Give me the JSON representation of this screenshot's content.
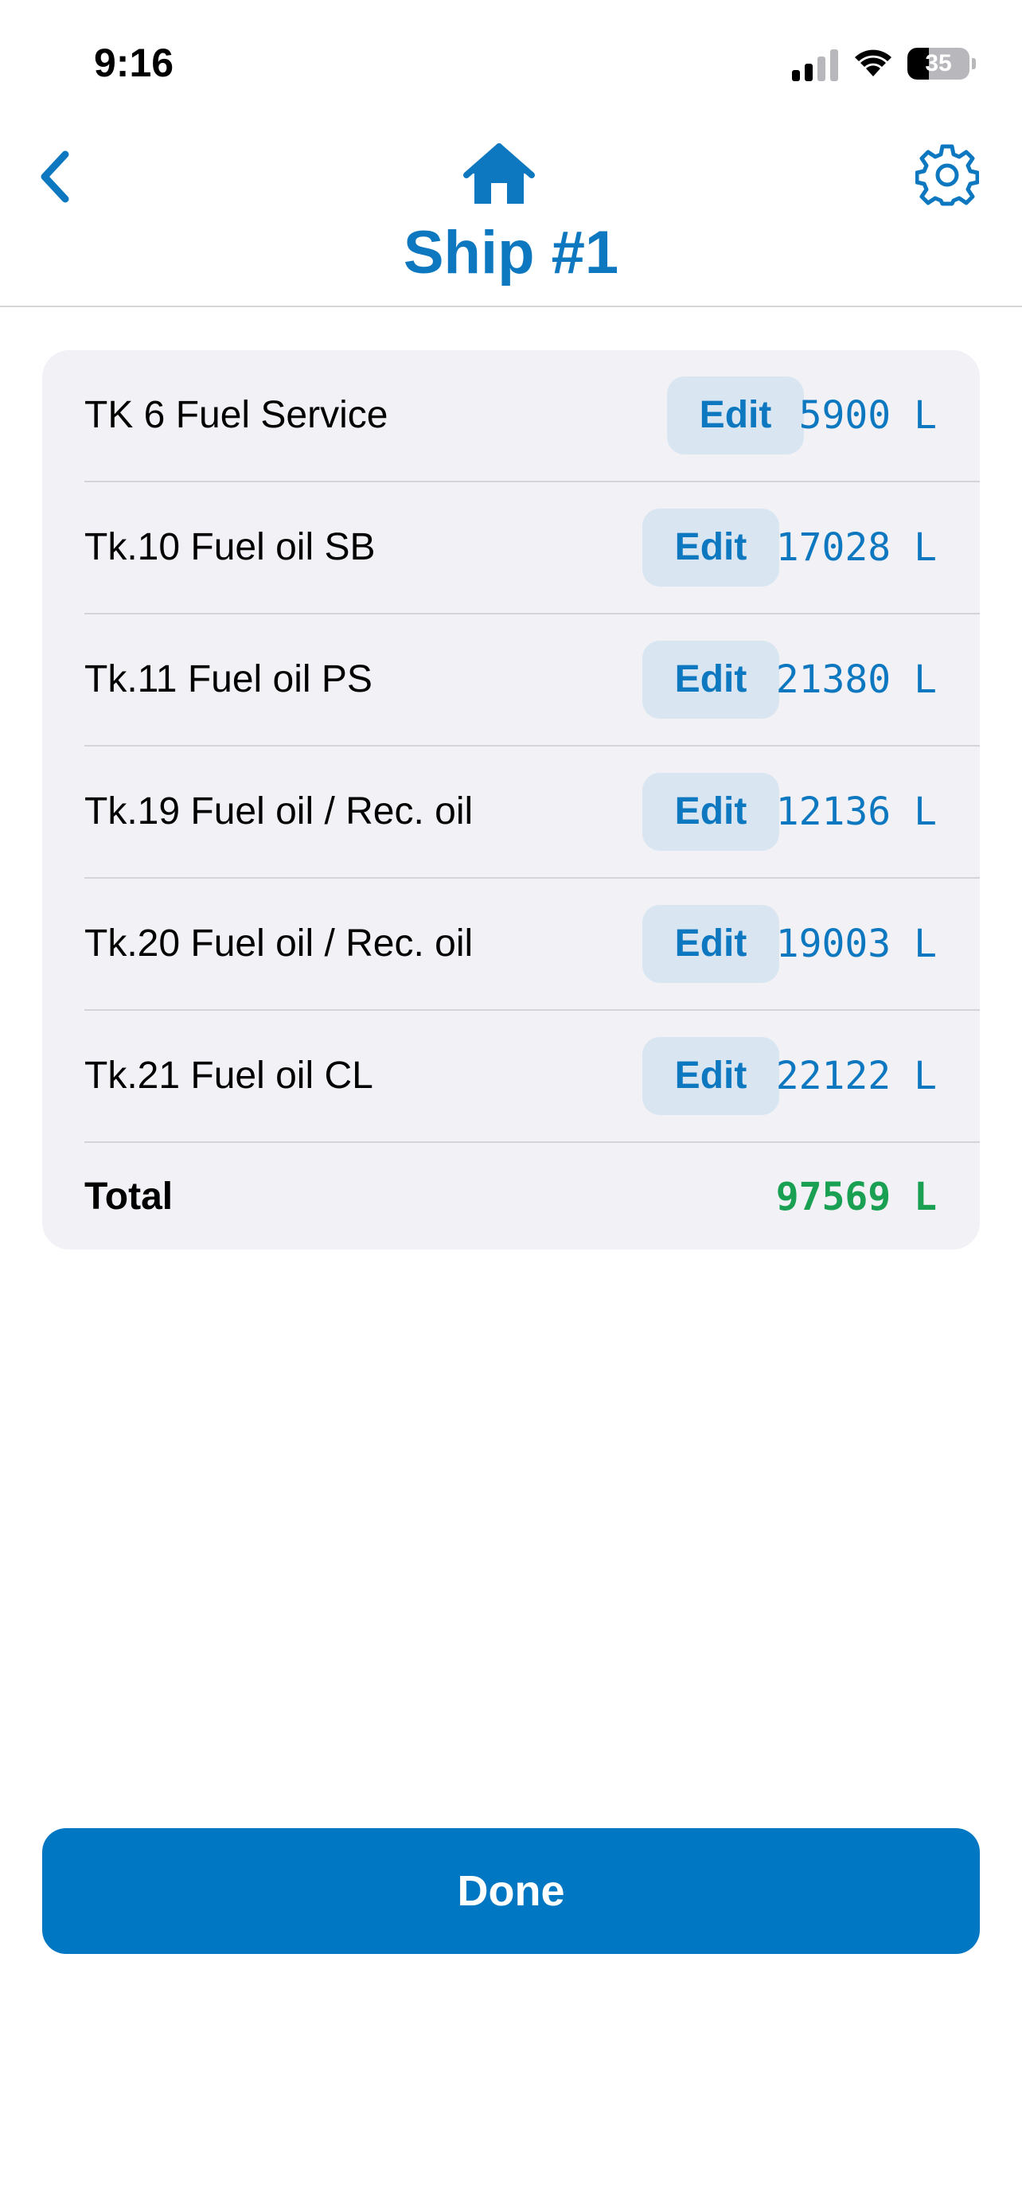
{
  "status_bar": {
    "time": "9:16",
    "battery_level": "35",
    "battery_fraction": 0.35
  },
  "nav": {
    "title": "Ship #1",
    "icons": {
      "back": "chevron-left-icon",
      "home": "home-icon",
      "settings": "gear-icon"
    },
    "accent_color": "#0d78c0"
  },
  "tanks": [
    {
      "label": "TK 6 Fuel Service",
      "edit_label": "Edit",
      "value": "5900 L"
    },
    {
      "label": "Tk.10 Fuel oil SB",
      "edit_label": "Edit",
      "value": "17028 L"
    },
    {
      "label": "Tk.11 Fuel oil PS",
      "edit_label": "Edit",
      "value": "21380 L"
    },
    {
      "label": "Tk.19 Fuel oil / Rec. oil",
      "edit_label": "Edit",
      "value": "12136 L"
    },
    {
      "label": "Tk.20 Fuel oil / Rec. oil",
      "edit_label": "Edit",
      "value": "19003 L"
    },
    {
      "label": "Tk.21 Fuel oil CL",
      "edit_label": "Edit",
      "value": "22122 L"
    }
  ],
  "total": {
    "label": "Total",
    "value": "97569 L",
    "color": "#1aa052"
  },
  "done_button": {
    "label": "Done",
    "color": "#0077c2"
  }
}
